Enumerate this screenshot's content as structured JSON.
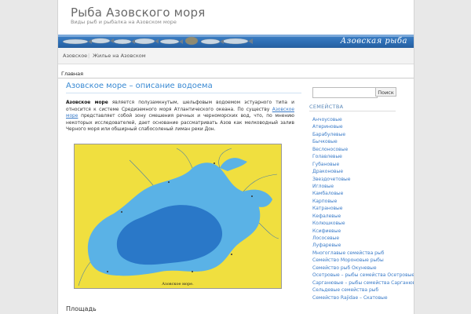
{
  "header": {
    "site_title": "Рыба Азовского моря",
    "site_description": "Виды рыб и рыбалка на Азовском море"
  },
  "banner": {
    "brand": "Азовская рыба"
  },
  "nav": {
    "items": [
      {
        "label": "Азовское"
      },
      {
        "label": "Жилье на Азовском"
      }
    ]
  },
  "subnav": {
    "home_label": "Главная"
  },
  "post": {
    "title": "Азовское море – описание водоема",
    "paragraph": {
      "bold_lead": "Азовское море",
      "text_1": " является полузамкнутым, шельфовым водоемом эстуарного типа и относится к системе Средиземного моря Атлантического океана. По существу ",
      "link_text": "Азовское море",
      "text_2": " представляет собой зону смешения речных и черноморских вод, что, по мнению некоторых исследователей, дает основание рассматривать Азов как мелководный залив Черного моря или обширный слабосоленый лиман реки Дон."
    },
    "map_caption": "Азовское море.",
    "next_heading": "Площадь"
  },
  "sidebar": {
    "search_button": "Поиск",
    "search_value": "",
    "categories_heading": "СЕМЕЙСТВА",
    "categories": [
      "Анчоусовые",
      "Атериновые",
      "Барабулевые",
      "Бычковые",
      "Веслоносовые",
      "Голавлевые",
      "Губановые",
      "Драконовые",
      "Звездочетовые",
      "Игловые",
      "Камбаловые",
      "Карповые",
      "Катрановые",
      "Кефалевые",
      "Колюшковые",
      "Ксифиевые",
      "Лососевые",
      "Луфаревые",
      "Многоглавые семейства рыб",
      "Семейство Мороновые рыбы",
      "Семейство рыб Окуневые",
      "Осетровые – рыбы семейства Осетровые",
      "Сарганювые – рыбы семейства Сарганювые",
      "Сельдевые семейства рыб",
      "Семейство Rajidae – Скатовые"
    ]
  },
  "colors": {
    "link": "#3a7bc8",
    "title_blue": "#3a8ad3",
    "banner_blue": "#2d6db3",
    "map_land": "#f0df3f",
    "map_shelf": "#5ab2e6",
    "map_deep": "#2a78c8"
  }
}
